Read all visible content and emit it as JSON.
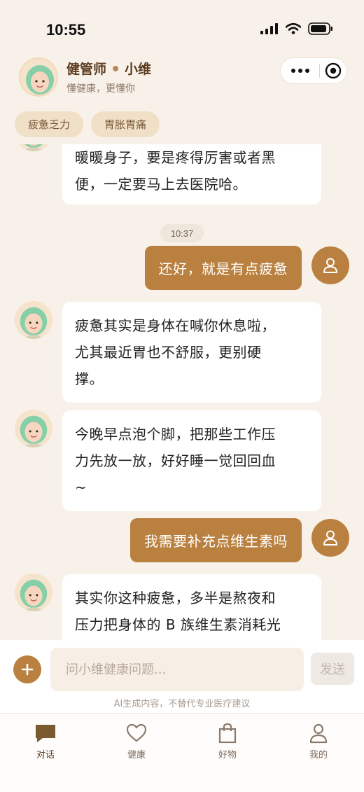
{
  "status_bar": {
    "time": "10:55"
  },
  "header": {
    "title": "健管师",
    "name": "小维",
    "subtitle": "懂健康，更懂你"
  },
  "tags": [
    "疲惫乏力",
    "胃胀胃痛"
  ],
  "messages": [
    {
      "role": "ai",
      "lines": [
        "暖暖身子，要是疼得厉害或者黑",
        "便，一定要马上去医院哈。"
      ]
    },
    {
      "role": "time",
      "text": "10:37"
    },
    {
      "role": "user",
      "text": "还好，就是有点疲惫"
    },
    {
      "role": "ai",
      "lines": [
        "疲惫其实是身体在喊你休息啦，",
        "尤其最近胃也不舒服，更别硬",
        "撑。"
      ]
    },
    {
      "role": "ai",
      "lines": [
        "今晚早点泡个脚，把那些工作压",
        "力先放一放，好好睡一觉回回血",
        "~"
      ]
    },
    {
      "role": "user",
      "text": "我需要补充点维生素吗"
    },
    {
      "role": "ai",
      "lines": [
        "其实你这种疲惫，多半是熬夜和",
        "压力把身体的 B 族维生素消耗光"
      ]
    }
  ],
  "input": {
    "placeholder": "问小维健康问题...",
    "send_label": "发送",
    "disclaimer": "AI生成内容，不替代专业医疗建议"
  },
  "tabs": [
    {
      "label": "对话",
      "icon": "chat-icon",
      "active": true
    },
    {
      "label": "健康",
      "icon": "heart-icon",
      "active": false
    },
    {
      "label": "好物",
      "icon": "shopping-bag-icon",
      "active": false
    },
    {
      "label": "我的",
      "icon": "user-icon",
      "active": false
    }
  ],
  "colors": {
    "accent": "#b9803f",
    "background": "#f8f1ea",
    "tag_bg": "#f0e0c8"
  }
}
